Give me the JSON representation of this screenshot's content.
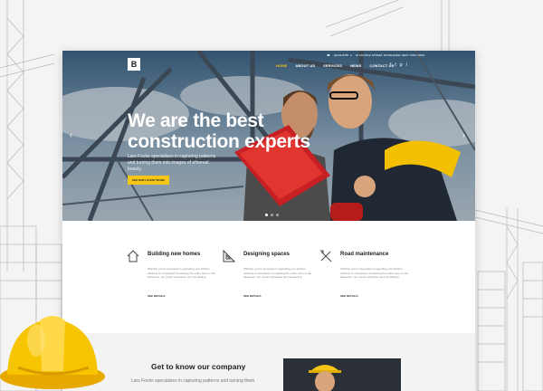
{
  "logo": {
    "letter": "B"
  },
  "topbar": {
    "phone": "(0)234-8765",
    "address": "18 CHURCH STREET, ROSELEADE, NEW YORK 10001"
  },
  "nav": {
    "items": [
      "HOME",
      "ABOUT US",
      "SERVICES",
      "NEWS",
      "CONTACT US"
    ],
    "active_index": 0
  },
  "social": [
    "f",
    "t",
    "p",
    "i"
  ],
  "hero": {
    "headline_line1": "We are the best",
    "headline_line2": "construction experts",
    "subtitle": "Lars Focke specializes in capturing patterns and turning them into images of ethereal beauty.",
    "cta_label": "SEE OUR LATEST WORK",
    "prev_icon": "chevron-left-icon",
    "next_icon": "chevron-right-icon"
  },
  "features": [
    {
      "icon": "house-icon",
      "title": "Building new homes",
      "description": "Whether you're interested in upgrading your kitchen cabinets or completely remodeling the entire room or the basement, our expert estimators and remodeling",
      "more": "SEE DETAILS"
    },
    {
      "icon": "blueprint-icon",
      "title": "Designing spaces",
      "description": "Whether you're interested in upgrading your kitchen cabinets or completely remodeling the entire room or the basement, our expert estimators and remodeling",
      "more": "SEE DETAILS"
    },
    {
      "icon": "tools-icon",
      "title": "Road maintenance",
      "description": "Whether you're interested in upgrading your kitchen cabinets or completely remodeling the entire room or the basement, our expert estimators and remodeling",
      "more": "SEE DETAILS"
    }
  ],
  "about": {
    "heading": "Get to know our company",
    "text": "Lars Focke specializes in capturing patterns and turning them"
  },
  "colors": {
    "accent": "#f5c518",
    "dark": "#222222"
  }
}
